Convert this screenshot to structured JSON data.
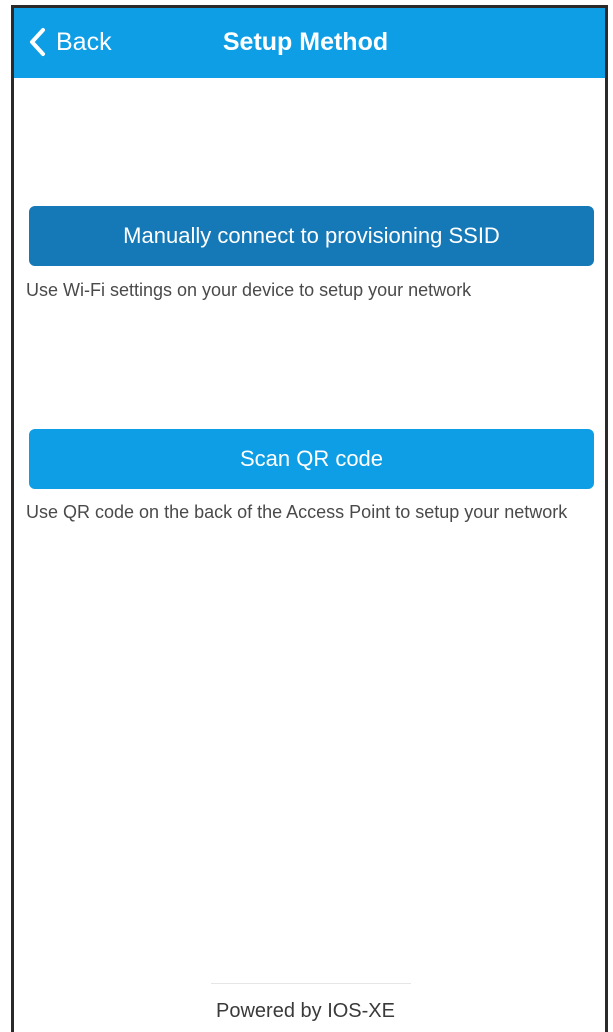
{
  "navbar": {
    "back_label": "Back",
    "title": "Setup Method",
    "background": "#0e9ee6"
  },
  "options": {
    "manual": {
      "button_label": "Manually connect to provisioning SSID",
      "description": "Use Wi-Fi settings on your device to setup your network",
      "color": "#1579b8"
    },
    "qr": {
      "button_label": "Scan QR code",
      "description": "Use QR code on the back of the Access Point to setup your network",
      "color": "#0e9ee6"
    }
  },
  "footer": {
    "text": "Powered by IOS-XE"
  },
  "icons": {
    "back": "chevron-left-icon"
  }
}
